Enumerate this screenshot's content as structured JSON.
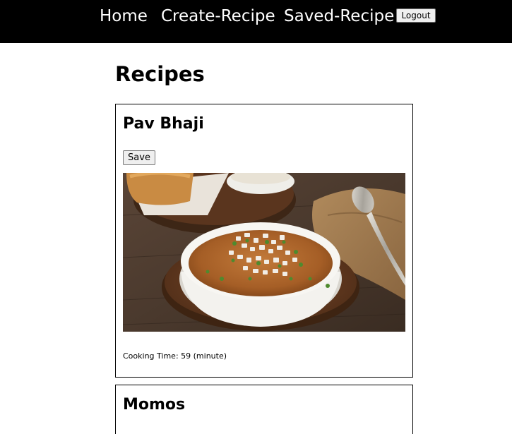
{
  "nav": {
    "home": "Home",
    "create_recipe": "Create-Recipe",
    "saved_recipe": "Saved-Recipe",
    "logout": "Logout"
  },
  "page": {
    "title": "Recipes"
  },
  "recipes": [
    {
      "name": "Pav Bhaji",
      "save_label": "Save",
      "image_subject": "bowl of pav bhaji with onions and coriander",
      "cooking_time": "Cooking Time: 59 (minute)"
    },
    {
      "name": "Momos"
    }
  ],
  "colors": {
    "navbar_bg": "#000000",
    "nav_text": "#ffffff",
    "page_bg": "#ffffff",
    "card_border": "#000000"
  }
}
